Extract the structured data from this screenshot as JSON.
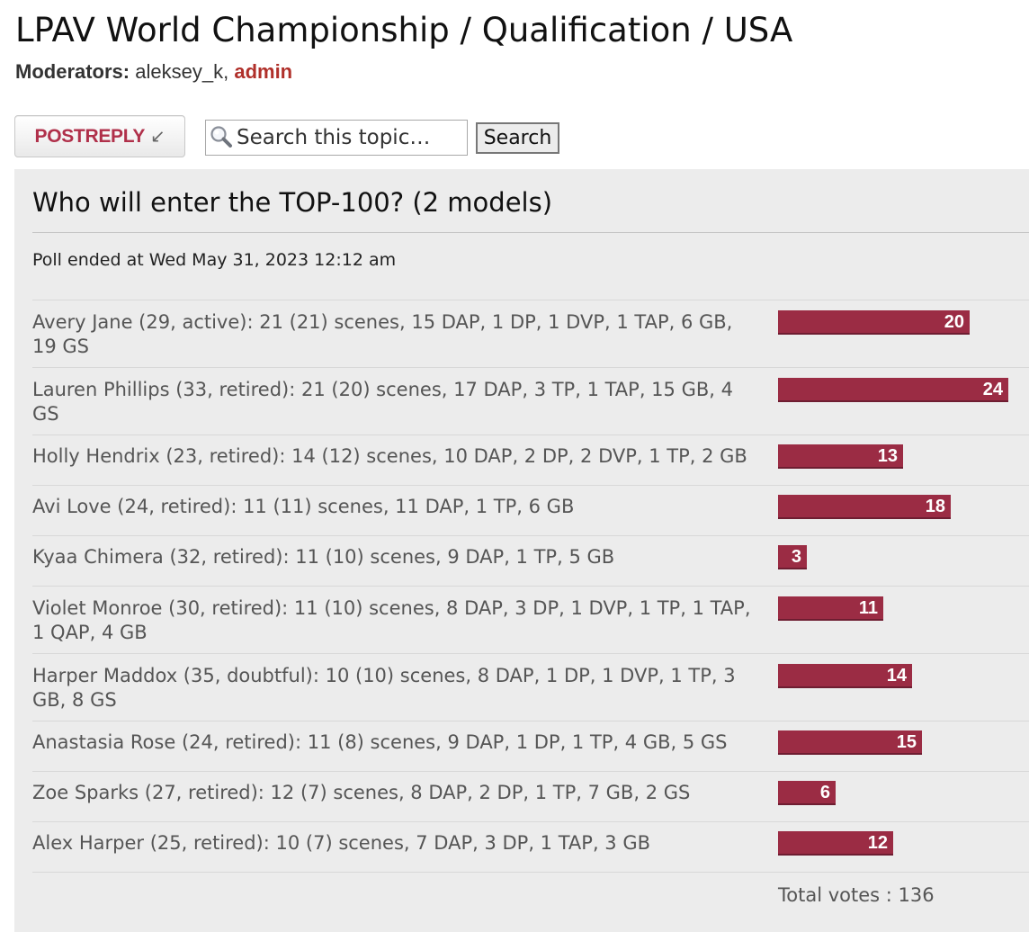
{
  "topic": {
    "title": "LPAV World Championship / Qualification / USA",
    "moderators_label": "Moderators:",
    "moderator_1": "aleksey_k,",
    "moderator_2": "admin"
  },
  "toolbar": {
    "post_reply_label": "POSTREPLY",
    "post_reply_icon": "reply-arrow-icon",
    "search_placeholder": "Search this topic…",
    "search_button_label": "Search"
  },
  "poll": {
    "question": "Who will enter the TOP-100? (2 models)",
    "ended": "Poll ended at Wed May 31, 2023 12:12 am",
    "bar_color": "#9b2c44",
    "total_votes_label": "Total votes : 136",
    "options": [
      {
        "text": "Avery Jane (29, active): 21 (21) scenes, 15 DAP, 1 DP, 1 DVP, 1 TAP, 6 GB, 19 GS",
        "votes": 20
      },
      {
        "text": "Lauren Phillips (33, retired): 21 (20) scenes, 17 DAP, 3 TP, 1 TAP, 15 GB, 4 GS",
        "votes": 24
      },
      {
        "text": "Holly Hendrix (23, retired): 14 (12) scenes, 10 DAP, 2 DP, 2 DVP, 1 TP, 2 GB",
        "votes": 13
      },
      {
        "text": "Avi Love (24, retired): 11 (11) scenes, 11 DAP, 1 TP, 6 GB",
        "votes": 18
      },
      {
        "text": "Kyaa Chimera (32, retired): 11 (10) scenes, 9 DAP, 1 TP, 5 GB",
        "votes": 3
      },
      {
        "text": "Violet Monroe (30, retired): 11 (10) scenes, 8 DAP, 3 DP, 1 DVP, 1 TP, 1 TAP, 1 QAP, 4 GB",
        "votes": 11
      },
      {
        "text": "Harper Maddox (35, doubtful): 10 (10) scenes, 8 DAP, 1 DP, 1 DVP, 1 TP, 3 GB, 8 GS",
        "votes": 14
      },
      {
        "text": "Anastasia Rose (24, retired): 11 (8) scenes, 9 DAP, 1 DP, 1 TP, 4 GB, 5 GS",
        "votes": 15
      },
      {
        "text": "Zoe Sparks (27, retired): 12 (7) scenes, 8 DAP, 2 DP, 1 TP, 7 GB, 2 GS",
        "votes": 6
      },
      {
        "text": "Alex Harper (25, retired): 10 (7) scenes, 7 DAP, 3 DP, 1 TAP, 3 GB",
        "votes": 12
      }
    ]
  }
}
